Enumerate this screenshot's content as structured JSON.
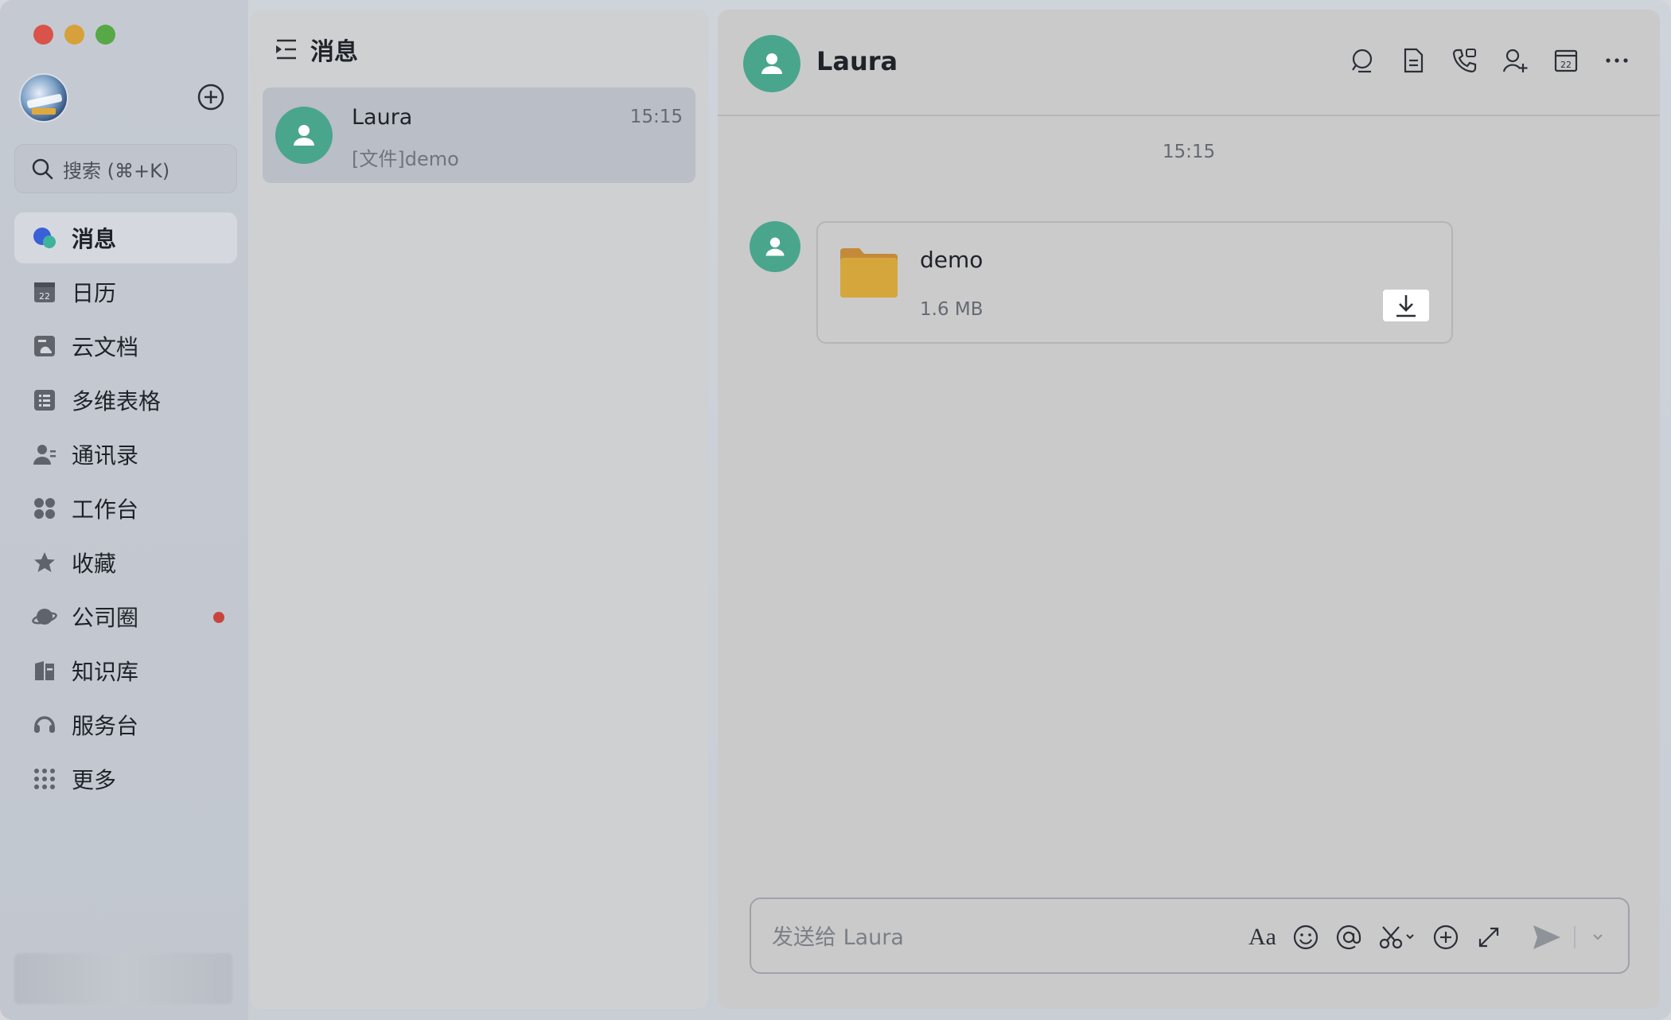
{
  "window": {
    "traffic_lights": [
      "close",
      "minimize",
      "maximize"
    ],
    "colors": {
      "close": "#d9534a",
      "minimize": "#d6a13a",
      "maximize": "#57a846",
      "accent_green": "#4aa58d"
    }
  },
  "sidebar": {
    "search": {
      "placeholder": "搜索 (⌘+K)"
    },
    "items": [
      {
        "label": "消息",
        "icon": "message-icon",
        "active": true
      },
      {
        "label": "日历",
        "icon": "calendar-icon",
        "icon_text": "22"
      },
      {
        "label": "云文档",
        "icon": "cloud-doc-icon"
      },
      {
        "label": "多维表格",
        "icon": "table-icon"
      },
      {
        "label": "通讯录",
        "icon": "contacts-icon"
      },
      {
        "label": "工作台",
        "icon": "workspace-icon"
      },
      {
        "label": "收藏",
        "icon": "star-icon"
      },
      {
        "label": "公司圈",
        "icon": "planet-icon",
        "badge": true
      },
      {
        "label": "知识库",
        "icon": "knowledge-icon"
      },
      {
        "label": "服务台",
        "icon": "headset-icon"
      },
      {
        "label": "更多",
        "icon": "more-grid-icon"
      }
    ]
  },
  "list": {
    "title": "消息",
    "conversations": [
      {
        "name": "Laura",
        "time": "15:15",
        "preview": "[文件]demo"
      }
    ]
  },
  "chat": {
    "title": "Laura",
    "tools": [
      "search-icon",
      "document-icon",
      "phone-icon",
      "add-member-icon",
      "calendar-icon",
      "more-icon"
    ],
    "tool_calendar_text": "22",
    "time_divider": "15:15",
    "file_message": {
      "name": "demo",
      "size": "1.6 MB",
      "icon": "folder-icon"
    },
    "composer": {
      "placeholder": "发送给 Laura",
      "format_label": "Aa",
      "tools": [
        "format-icon",
        "emoji-icon",
        "mention-icon",
        "screenshot-icon",
        "add-icon",
        "expand-icon",
        "send-icon",
        "send-options-icon"
      ]
    }
  }
}
